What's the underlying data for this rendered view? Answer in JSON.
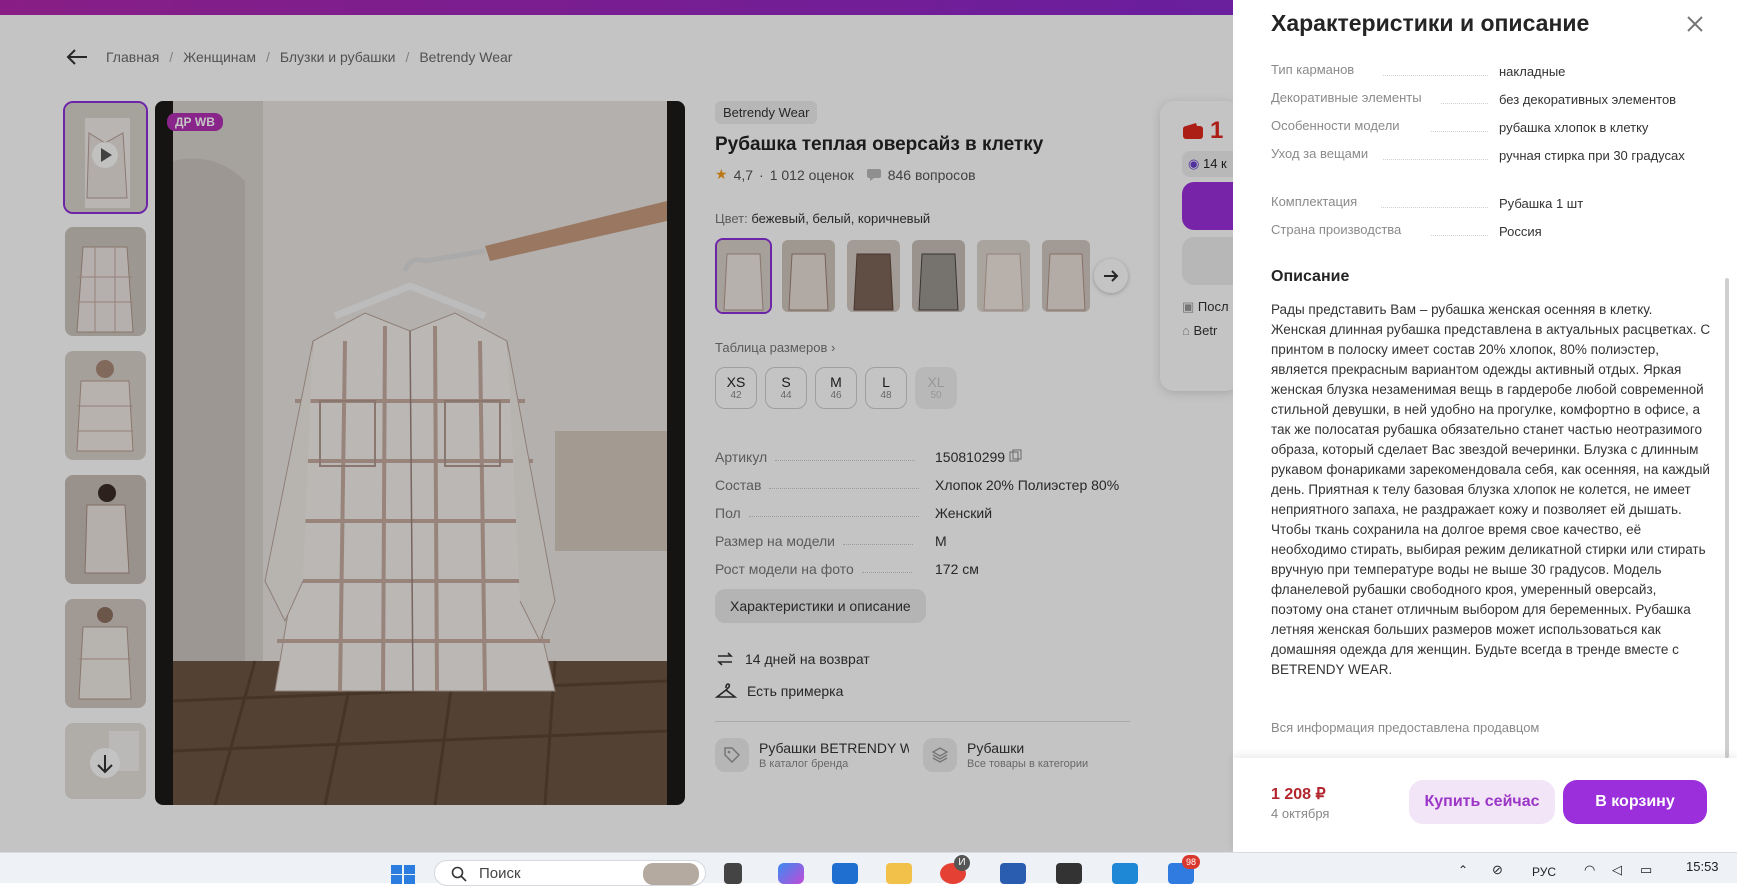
{
  "breadcrumb": {
    "items": [
      "Главная",
      "Женщинам",
      "Блузки и рубашки",
      "Betrendy Wear"
    ]
  },
  "gallery": {
    "badge": "ДР WB"
  },
  "product": {
    "brand": "Betrendy Wear",
    "title": "Рубашка теплая оверсайз в клетку",
    "rating": "4,7",
    "reviews": "1 012 оценок",
    "questions": "846 вопросов",
    "color_label": "Цвет:",
    "color_value": "бежевый, белый, коричневый",
    "size_table_link": "Таблица размеров",
    "sizes": [
      {
        "size": "XS",
        "num": "42",
        "available": true
      },
      {
        "size": "S",
        "num": "44",
        "available": true
      },
      {
        "size": "M",
        "num": "46",
        "available": true
      },
      {
        "size": "L",
        "num": "48",
        "available": true
      },
      {
        "size": "XL",
        "num": "50",
        "available": false
      }
    ],
    "params": [
      {
        "key": "Артикул",
        "value": "150810299"
      },
      {
        "key": "Состав",
        "value": "Хлопок 20% Полиэстер 80%"
      },
      {
        "key": "Пол",
        "value": "Женский"
      },
      {
        "key": "Размер на модели",
        "value": "M"
      },
      {
        "key": "Рост модели на фото",
        "value": "172 см"
      }
    ],
    "characteristics_button": "Характеристики и описание",
    "features": [
      "14 дней на возврат",
      "Есть примерка"
    ],
    "categories": [
      {
        "title": "Рубашки BETRENDY WEAR",
        "subtitle": "В каталог бренда"
      },
      {
        "title": "Рубашки",
        "subtitle": "Все товары в категории"
      }
    ]
  },
  "buybox_partial": {
    "price_fragment": "1",
    "line1": "14 к",
    "line2": "Посл",
    "line3": "Betr"
  },
  "panel": {
    "title": "Характеристики и описание",
    "characteristics": [
      {
        "key": "Тип карманов",
        "value": "накладные"
      },
      {
        "key": "Декоративные элементы",
        "value": "без декоративных элементов"
      },
      {
        "key": "Особенности модели",
        "value": "рубашка хлопок в клетку"
      },
      {
        "key": "Уход за вещами",
        "value": "ручная стирка при 30 градусах"
      },
      {
        "key": "Комплектация",
        "value": "Рубашка 1 шт"
      },
      {
        "key": "Страна производства",
        "value": "Россия"
      }
    ],
    "description_title": "Описание",
    "description": "Рады представить Вам – рубашка женская осенняя в клетку. Женская длинная рубашка представлена в актуальных расцветках. С принтом в полоску имеет состав 20% хлопок, 80% полиэстер, является прекрасным вариантом одежды активный отдых. Яркая женская блузка незаменимая вещь в гардеробе любой современной стильной девушки, в ней удобно на прогулке, комфортно в офисе, а так же полосатая рубашка обязательно станет частью неотразимого образа, который сделает Вас звездой вечеринки. Блузка с длинным рукавом фонариками зарекомендовала себя, как осенняя, на каждый день. Приятная к телу базовая блузка хлопок не колется, не имеет неприятного запаха, не раздражает кожу и позволяет ей дышать. Чтобы ткань сохранила на долгое время свое качество, её необходимо стирать, выбирая режим деликатной стирки или стирать вручную при температуре воды не выше 30 градусов. Модель фланелевой рубашки свободного кроя, умеренный оверсайз, поэтому она станет отличным выбором для беременных. Рубашка летняя женская больших размеров может использоваться как домашняя одежда для женщин. Будьте всегда в тренде вместе с BETRENDY WEAR.",
    "seller_note": "Вся информация предоставлена продавцом",
    "price": "1 208 ₽",
    "delivery_date": "4 октября",
    "buy_now": "Купить сейчас",
    "add_to_cart": "В корзину"
  },
  "taskbar": {
    "search_placeholder": "Поиск",
    "language": "РУС",
    "time": "15:53",
    "notification_badge": "98",
    "avatar_letter": "И"
  },
  "colors": {
    "accent": "#9b2fdb",
    "price": "#b3262e",
    "topbar": "#a528b8"
  }
}
